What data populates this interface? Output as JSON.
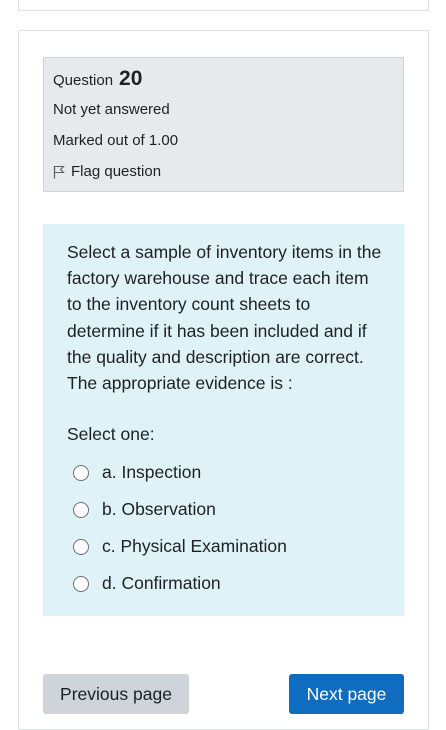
{
  "question": {
    "label": "Question",
    "number": "20",
    "status": "Not yet answered",
    "marks": "Marked out of 1.00",
    "flag_label": "Flag question"
  },
  "content": {
    "text": "Select a sample of inventory items in the factory warehouse and trace each item to the inventory count sheets to determine if it has been included and if the quality and description are correct. The  appropriate evidence is :",
    "prompt": "Select one:",
    "options": [
      {
        "label": "a. Inspection"
      },
      {
        "label": "b. Observation"
      },
      {
        "label": "c. Physical Examination"
      },
      {
        "label": "d. Confirmation"
      }
    ]
  },
  "navigation": {
    "previous_label": "Previous page",
    "next_label": "Next page"
  },
  "colors": {
    "info_bg": "#e7e9ec",
    "content_bg": "#def2f8",
    "next_button": "#0f6cbf",
    "previous_button": "#ced4da"
  },
  "icons": {
    "flag": "flag-outline-icon"
  }
}
